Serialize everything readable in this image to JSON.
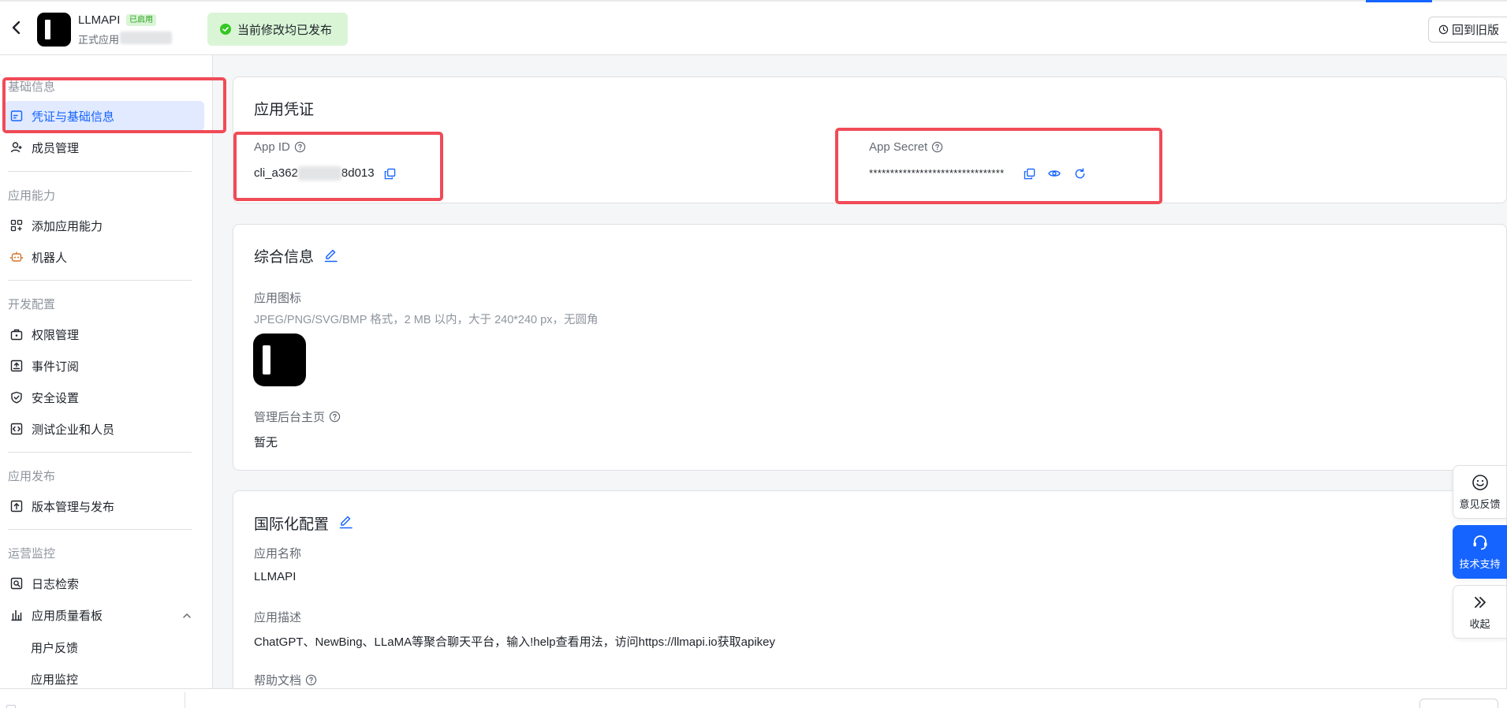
{
  "header": {
    "app_name": "LLMAPI",
    "status_tag": "已启用",
    "app_kind": "正式应用",
    "publish_banner": "当前修改均已发布",
    "old_version_button": "回到旧版"
  },
  "sidebar": {
    "groups": {
      "basic": "基础信息",
      "capability": "应用能力",
      "dev": "开发配置",
      "release": "应用发布",
      "ops": "运营监控"
    },
    "items": {
      "credentials": "凭证与基础信息",
      "members": "成员管理",
      "add_capability": "添加应用能力",
      "bot": "机器人",
      "permissions": "权限管理",
      "events": "事件订阅",
      "security": "安全设置",
      "test_org": "测试企业和人员",
      "versions": "版本管理与发布",
      "logs": "日志检索",
      "quality": "应用质量看板",
      "feedback": "用户反馈",
      "monitor": "应用监控"
    }
  },
  "credentials_card": {
    "title": "应用凭证",
    "app_id_label": "App ID",
    "app_id_prefix": "cli_a362",
    "app_id_suffix": "8d013",
    "app_secret_label": "App Secret",
    "app_secret_value": "********************************"
  },
  "general_card": {
    "title": "综合信息",
    "icon_label": "应用图标",
    "icon_hint": "JPEG/PNG/SVG/BMP 格式，2 MB 以内，大于 240*240 px，无圆角",
    "homepage_label": "管理后台主页",
    "homepage_value": "暂无"
  },
  "i18n_card": {
    "title": "国际化配置",
    "name_label": "应用名称",
    "name_value": "LLMAPI",
    "desc_label": "应用描述",
    "desc_value": "ChatGPT、NewBing、LLaMA等聚合聊天平台，输入!help查看用法，访问https://llmapi.io获取apikey",
    "help_label": "帮助文档"
  },
  "float_buttons": {
    "feedback": "意见反馈",
    "support": "技术支持",
    "collapse": "收起"
  },
  "colors": {
    "accent": "#1664ff",
    "annotation": "#f04b57",
    "success": "#34c724"
  }
}
